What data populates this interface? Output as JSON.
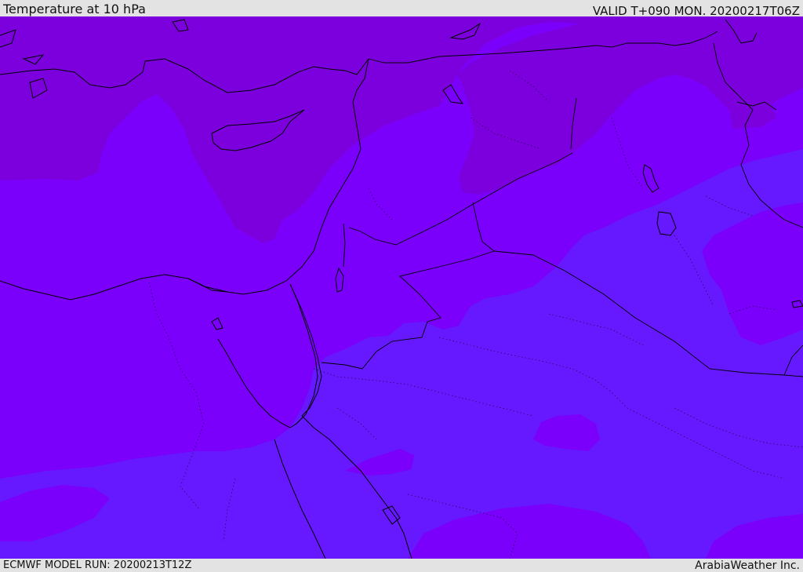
{
  "header": {
    "title": "Temperature at 10 hPa",
    "valid": "VALID T+090 MON. 20200217T06Z"
  },
  "footer": {
    "model_run": "ECMWF MODEL RUN: 20200213T12Z",
    "credit": "ArabiaWeather Inc."
  },
  "colors": {
    "band_warmest": "#6619ff",
    "band_mid": "#7a00fc",
    "band_cold": "#7c00de",
    "coastline": "#000000"
  }
}
